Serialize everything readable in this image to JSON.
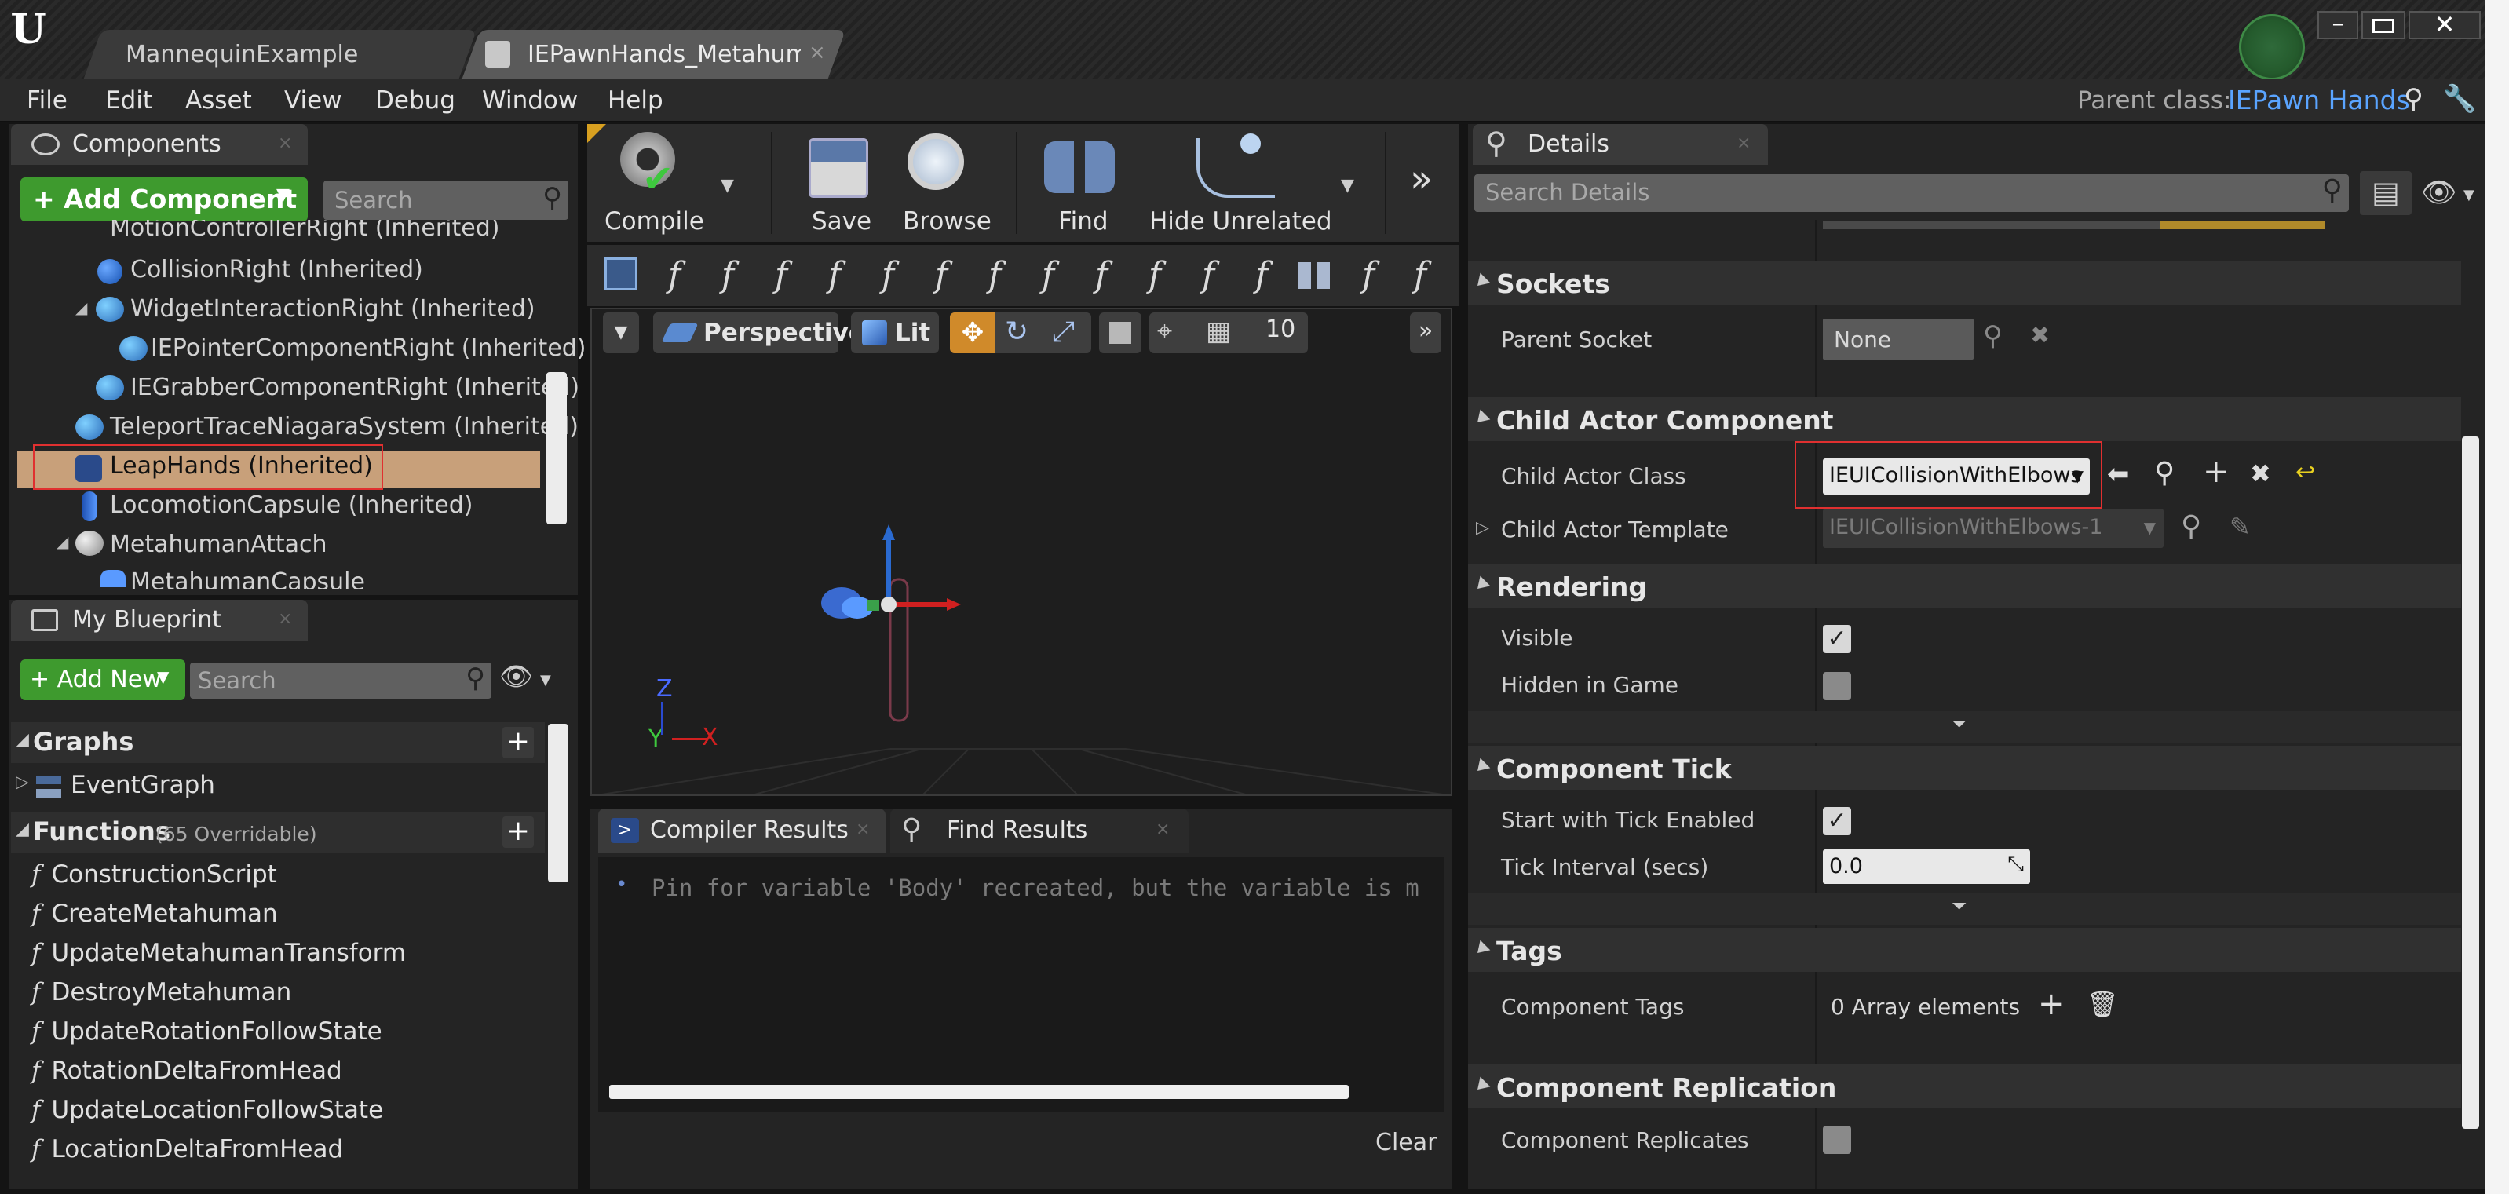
{
  "window": {
    "tabs": [
      {
        "label": "MannequinExample"
      },
      {
        "label": "IEPawnHands_Metahuma"
      }
    ]
  },
  "menu": {
    "items": [
      "File",
      "Edit",
      "Asset",
      "View",
      "Debug",
      "Window",
      "Help"
    ],
    "parent_class_label": "Parent class:",
    "parent_class_value": "IEPawn Hands"
  },
  "components": {
    "title": "Components",
    "add_label": "+ Add Component",
    "search_placeholder": "Search",
    "items": [
      "MotionControllerRight (Inherited)",
      "CollisionRight (Inherited)",
      "WidgetInteractionRight (Inherited)",
      "IEPointerComponentRight (Inherited)",
      "IEGrabberComponentRight (Inherited)",
      "TeleportTraceNiagaraSystem (Inherited)",
      "LeapHands (Inherited)",
      "LocomotionCapsule (Inherited)",
      "MetahumanAttach",
      "MetahumanCapsule"
    ]
  },
  "my_blueprint": {
    "title": "My Blueprint",
    "add_label": "+ Add New",
    "search_placeholder": "Search",
    "graphs_label": "Graphs",
    "event_graph": "EventGraph",
    "functions_label": "Functions",
    "functions_count": "(65 Overridable)",
    "functions": [
      "ConstructionScript",
      "CreateMetahuman",
      "UpdateMetahumanTransform",
      "DestroyMetahuman",
      "UpdateRotationFollowState",
      "RotationDeltaFromHead",
      "UpdateLocationFollowState",
      "LocationDeltaFromHead"
    ]
  },
  "toolbar": {
    "compile": "Compile",
    "save": "Save",
    "browse": "Browse",
    "find": "Find",
    "hide_unrelated": "Hide Unrelated"
  },
  "viewport": {
    "perspective": "Perspective",
    "lit": "Lit",
    "grid_size": "10",
    "axis_z": "Z",
    "axis_y": "Y",
    "axis_x": "X"
  },
  "results": {
    "tab_compiler": "Compiler Results",
    "tab_find": "Find Results",
    "message": "Pin for variable 'Body' recreated, but the variable is m",
    "clear": "Clear"
  },
  "details": {
    "title": "Details",
    "search_placeholder": "Search Details",
    "sockets": "Sockets",
    "parent_socket": "Parent Socket",
    "parent_socket_value": "None",
    "child_actor_component": "Child Actor Component",
    "child_actor_class": "Child Actor Class",
    "child_actor_class_value": "IEUICollisionWithElbows",
    "child_actor_template": "Child Actor Template",
    "child_actor_template_value": "IEUICollisionWithElbows-1",
    "rendering": "Rendering",
    "visible": "Visible",
    "hidden_in_game": "Hidden in Game",
    "component_tick": "Component Tick",
    "start_with_tick": "Start with Tick Enabled",
    "tick_interval": "Tick Interval (secs)",
    "tick_interval_value": "0.0",
    "tags": "Tags",
    "component_tags": "Component Tags",
    "component_tags_value": "0 Array elements",
    "component_replication": "Component Replication",
    "component_replicates": "Component Replicates"
  }
}
